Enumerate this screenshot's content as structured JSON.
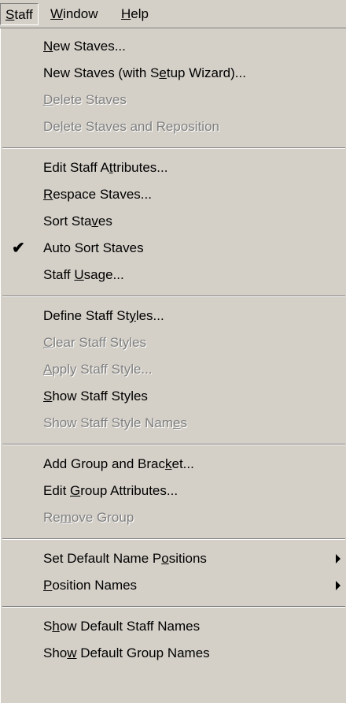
{
  "menubar": {
    "items": [
      {
        "label": "Staff",
        "mnemonic_index": 0
      },
      {
        "label": "Window",
        "mnemonic_index": 0
      },
      {
        "label": "Help",
        "mnemonic_index": 0
      }
    ]
  },
  "menu": {
    "title": "Staff",
    "items": [
      {
        "label": "New Staves...",
        "mnemonic_index": 0,
        "enabled": true
      },
      {
        "label": "New Staves (with Setup Wizard)...",
        "mnemonic_index": 18,
        "enabled": true
      },
      {
        "label": "Delete Staves",
        "mnemonic_index": 0,
        "enabled": false
      },
      {
        "label": "Delete Staves and Reposition",
        "mnemonic_index": 2,
        "enabled": false
      },
      {
        "label": "Edit Staff Attributes...",
        "mnemonic_index": 12,
        "enabled": true
      },
      {
        "label": "Respace Staves...",
        "mnemonic_index": 0,
        "enabled": true
      },
      {
        "label": "Sort Staves",
        "mnemonic_index": 8,
        "enabled": true
      },
      {
        "label": "Auto Sort Staves",
        "mnemonic_index": -1,
        "enabled": true,
        "checked": true
      },
      {
        "label": "Staff Usage...",
        "mnemonic_index": 6,
        "enabled": true
      },
      {
        "label": "Define Staff Styles...",
        "mnemonic_index": 15,
        "enabled": true
      },
      {
        "label": "Clear Staff Styles",
        "mnemonic_index": 0,
        "enabled": false
      },
      {
        "label": "Apply Staff Style...",
        "mnemonic_index": 0,
        "enabled": false
      },
      {
        "label": "Show Staff Styles",
        "mnemonic_index": 0,
        "enabled": true
      },
      {
        "label": "Show Staff Style Names",
        "mnemonic_index": 20,
        "enabled": false
      },
      {
        "label": "Add Group and Bracket...",
        "mnemonic_index": 18,
        "enabled": true
      },
      {
        "label": "Edit Group Attributes...",
        "mnemonic_index": 5,
        "enabled": true
      },
      {
        "label": "Remove Group",
        "mnemonic_index": 2,
        "enabled": false
      },
      {
        "label": "Set Default Name Positions",
        "mnemonic_index": 18,
        "enabled": true,
        "submenu": true
      },
      {
        "label": "Position Names",
        "mnemonic_index": 0,
        "enabled": true,
        "submenu": true
      },
      {
        "label": "Show Default Staff Names",
        "mnemonic_index": 1,
        "enabled": true
      },
      {
        "label": "Show Default Group Names",
        "mnemonic_index": 3,
        "enabled": true
      }
    ]
  },
  "icons": {
    "check": "checkmark-icon",
    "submenu": "submenu-arrow-icon"
  },
  "colors": {
    "menu_bg": "#d4d0c8",
    "disabled_text": "#808080",
    "highlight_shadow": "#ffffff",
    "separator_dark": "#808080"
  }
}
